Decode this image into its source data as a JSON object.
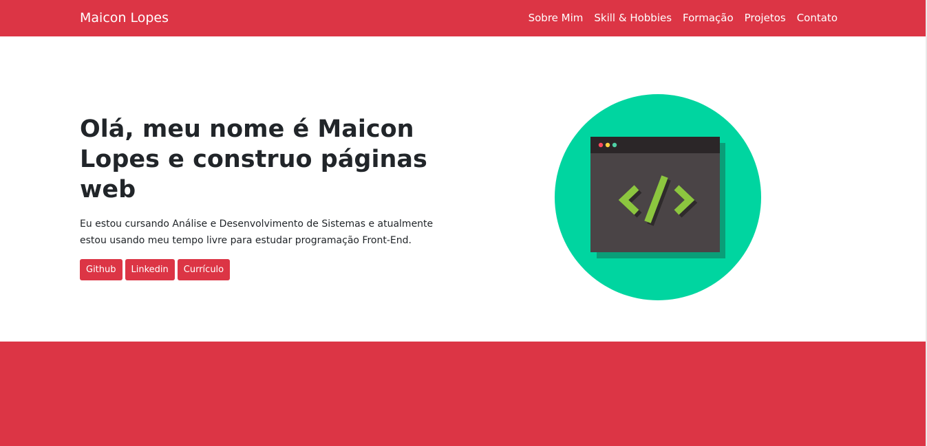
{
  "navbar": {
    "brand": "Maicon Lopes",
    "links": [
      "Sobre Mim",
      "Skill & Hobbies",
      "Formação",
      "Projetos",
      "Contato"
    ]
  },
  "hero": {
    "title": "Olá, meu nome é Maicon Lopes e construo páginas web",
    "description": "Eu estou cursando Análise e Desenvolvimento de Sistemas e atualmente estou usando meu tempo livre para estudar programação Front-End.",
    "buttons": [
      "Github",
      "Linkedin",
      "Currículo"
    ],
    "illustration": {
      "icon": "code-window-icon",
      "code_glyph": "</>"
    }
  },
  "colors": {
    "brand_red": "#dc3545",
    "circle_green": "#00d5a0",
    "window_dark": "#4a4446",
    "code_green": "#8cc63f",
    "text_dark": "#212529"
  }
}
